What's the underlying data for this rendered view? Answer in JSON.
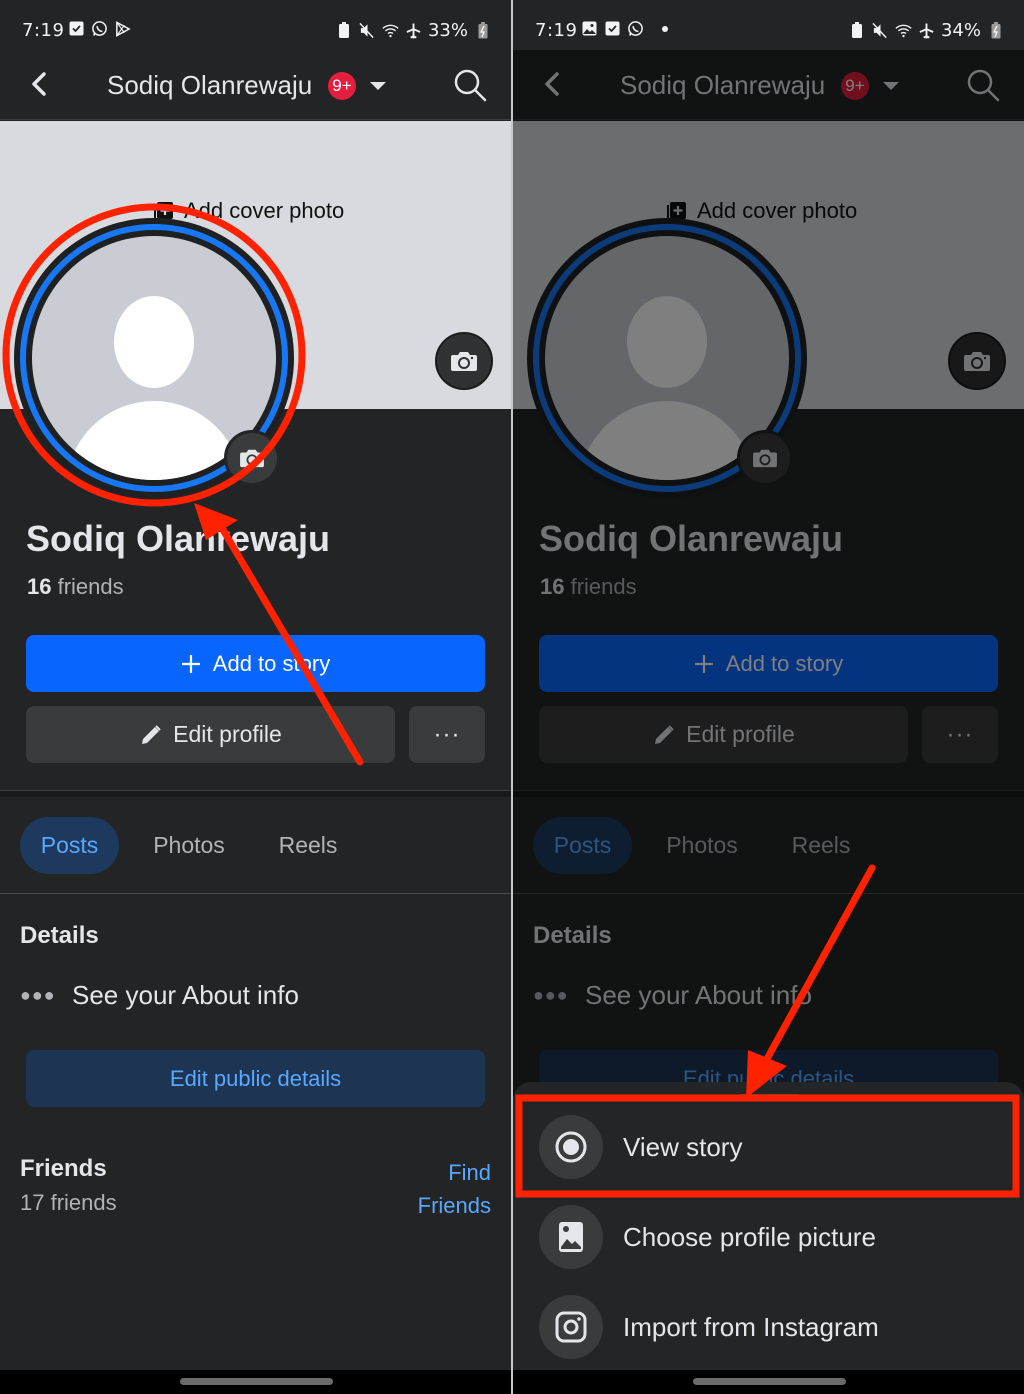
{
  "left": {
    "status_bar": {
      "time": "7:19",
      "battery": "33%",
      "left_icons": [
        "checkbox-icon",
        "whatsapp-icon",
        "play-store-icon"
      ],
      "right_icons": [
        "battery-saver-icon",
        "mute-icon",
        "wifi-icon",
        "airplane-icon",
        "battery-charging-icon"
      ]
    },
    "top_bar": {
      "title": "Sodiq Olanrewaju",
      "notification_badge": "9+"
    },
    "cover": {
      "add_cover_label": "Add cover photo"
    },
    "profile": {
      "name": "Sodiq Olanrewaju",
      "friends_count": "16",
      "friends_label": "friends"
    },
    "buttons": {
      "add_to_story": "Add to story",
      "edit_profile": "Edit profile",
      "more": "···"
    },
    "tabs": [
      {
        "label": "Posts",
        "active": true
      },
      {
        "label": "Photos",
        "active": false
      },
      {
        "label": "Reels",
        "active": false
      }
    ],
    "details": {
      "title": "Details",
      "about": "See your About info",
      "edit_public": "Edit public details"
    },
    "friends": {
      "title": "Friends",
      "count_text": "17 friends",
      "find_line1": "Find",
      "find_line2": "Friends"
    }
  },
  "right": {
    "status_bar": {
      "time": "7:19",
      "battery": "34%",
      "left_icons": [
        "gallery-icon",
        "checkbox-icon",
        "whatsapp-icon",
        "dot"
      ],
      "right_icons": [
        "battery-saver-icon",
        "mute-icon",
        "wifi-icon",
        "airplane-icon",
        "battery-charging-icon"
      ]
    },
    "top_bar": {
      "title": "Sodiq Olanrewaju",
      "notification_badge": "9+"
    },
    "cover": {
      "add_cover_label": "Add cover photo"
    },
    "profile": {
      "name": "Sodiq Olanrewaju",
      "friends_count": "16",
      "friends_label": "friends"
    },
    "buttons": {
      "add_to_story": "Add to story",
      "edit_profile": "Edit profile",
      "more": "···"
    },
    "tabs": [
      {
        "label": "Posts",
        "active": true
      },
      {
        "label": "Photos",
        "active": false
      },
      {
        "label": "Reels",
        "active": false
      }
    ],
    "details": {
      "title": "Details",
      "about": "See your About info",
      "edit_public": "Edit public details"
    },
    "sheet": {
      "items": [
        {
          "label": "View story",
          "icon": "radio-dot-icon",
          "highlighted": true
        },
        {
          "label": "Choose profile picture",
          "icon": "image-icon",
          "highlighted": false
        },
        {
          "label": "Import from Instagram",
          "icon": "instagram-icon",
          "highlighted": false
        }
      ]
    }
  },
  "colors": {
    "accent": "#0866ff",
    "link": "#5aa7ff",
    "badge": "#e41e3f",
    "annotation": "#ff2200",
    "background": "#232425"
  }
}
